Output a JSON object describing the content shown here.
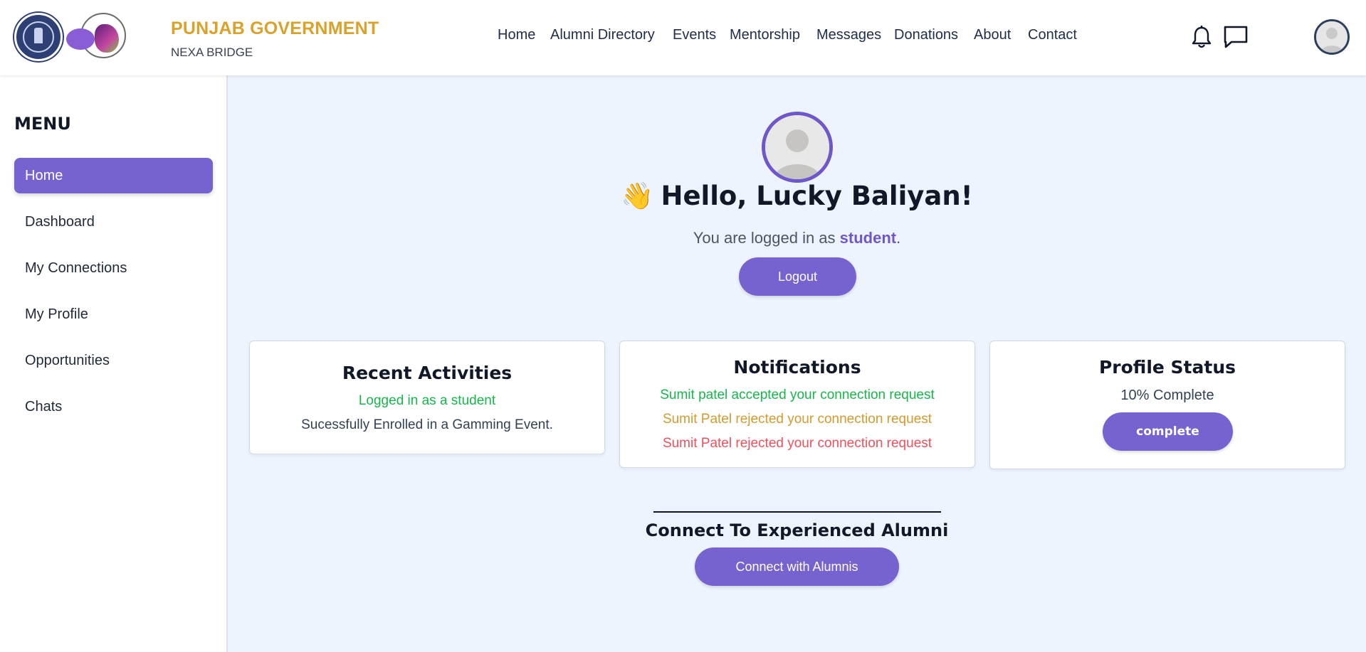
{
  "header": {
    "brand_title": "PUNJAB GOVERNMENT",
    "brand_subtitle": "NEXA BRIDGE",
    "nav": [
      "Home",
      "Alumni Directory",
      "Events",
      "Mentorship",
      "Messages",
      "Donations",
      "About",
      "Contact"
    ],
    "icons": [
      "bell-icon",
      "message-icon",
      "user-avatar"
    ]
  },
  "sidebar": {
    "title": "MENU",
    "items": [
      {
        "label": "Home",
        "active": true
      },
      {
        "label": "Dashboard",
        "active": false
      },
      {
        "label": "My Connections",
        "active": false
      },
      {
        "label": "My Profile",
        "active": false
      },
      {
        "label": "Opportunities",
        "active": false
      },
      {
        "label": "Chats",
        "active": false
      }
    ]
  },
  "main": {
    "wave": "👋",
    "greeting": "Hello, Lucky Baliyan!",
    "logged_prefix": "You are logged in as ",
    "role": "student",
    "logged_suffix": ".",
    "logout_label": "Logout",
    "cards": {
      "activities": {
        "title": "Recent Activities",
        "lines": [
          "Logged in as a student",
          "Sucessfully Enrolled in a Gamming Event."
        ]
      },
      "notifications": {
        "title": "Notifications",
        "lines": [
          "Sumit patel accepted your connection request",
          "Sumit Patel rejected your connection request",
          "Sumit Patel rejected your connection request"
        ]
      },
      "profile": {
        "title": "Profile Status",
        "status": "10% Complete",
        "progress": 0.1,
        "button_label": "complete"
      }
    },
    "connect_title": "Connect To Experienced Alumni",
    "connect_button": "Connect with Alumnis"
  },
  "colors": {
    "accent": "#7763cf",
    "brand_gold": "#d9a22a",
    "success": "#16b64a",
    "warning": "#d49a2e",
    "danger": "#f0505e",
    "background": "#eef4fe"
  }
}
